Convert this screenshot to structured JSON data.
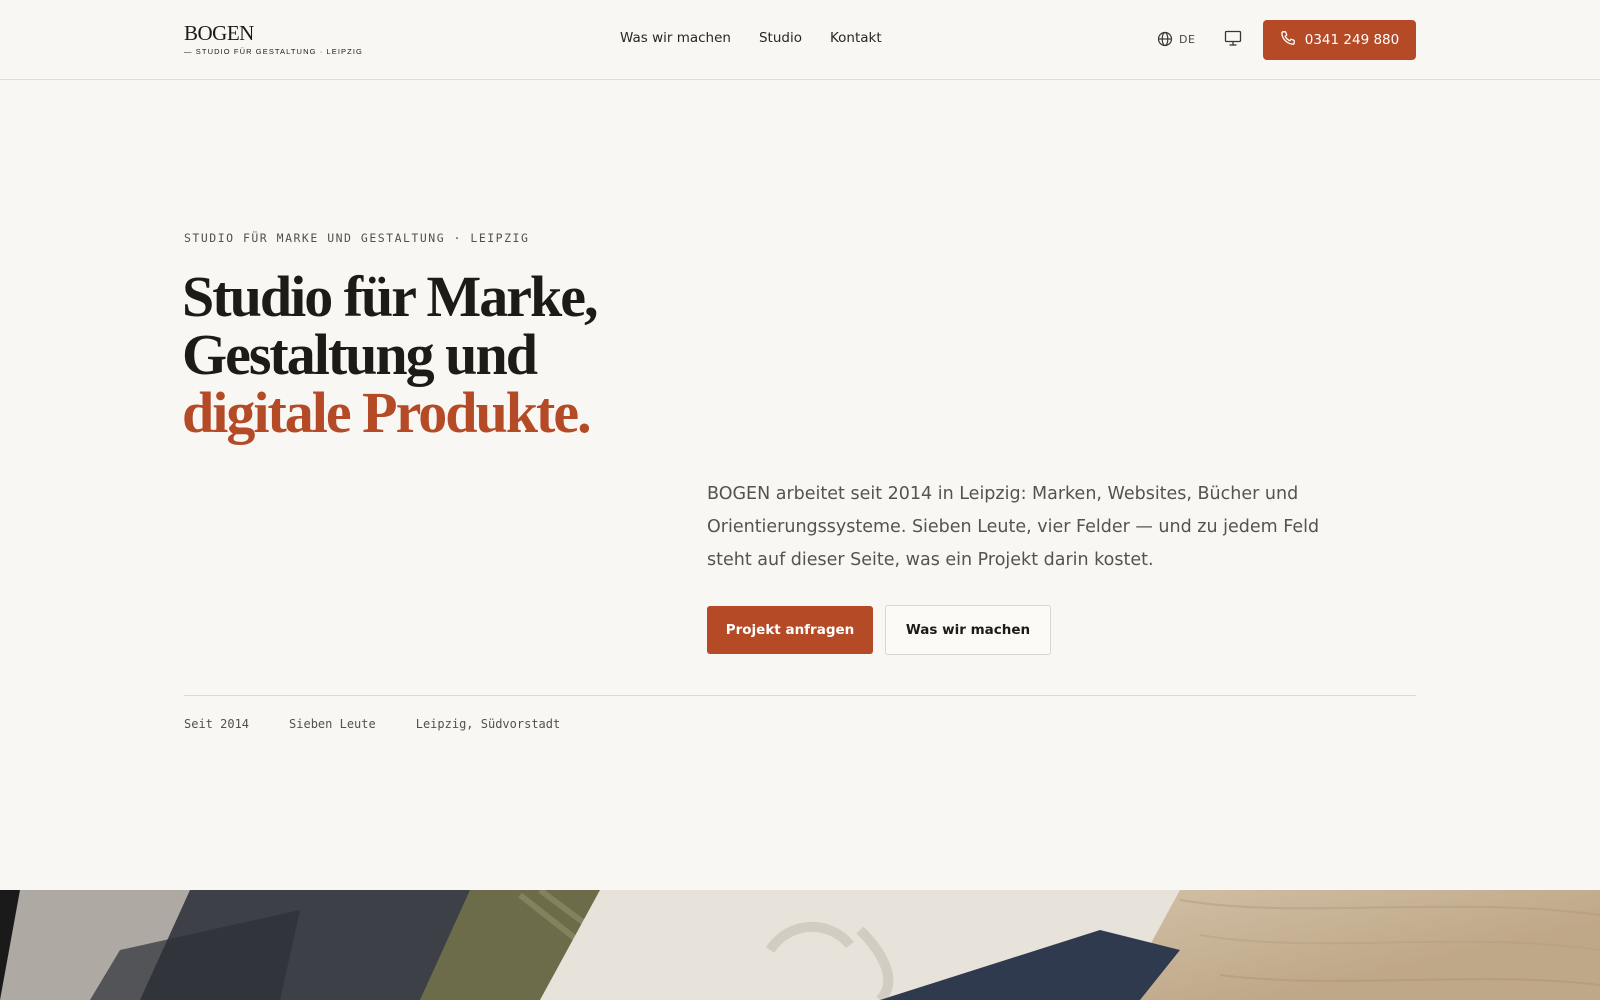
{
  "header": {
    "logo_word": "BOGEN",
    "logo_tagline": "— STUDIO FÜR GESTALTUNG · LEIPZIG",
    "nav": [
      {
        "label": "Was wir machen"
      },
      {
        "label": "Studio"
      },
      {
        "label": "Kontakt"
      }
    ],
    "language": "DE",
    "phone": "0341 249 880"
  },
  "hero": {
    "eyebrow": "STUDIO FÜR MARKE UND GESTALTUNG · LEIPZIG",
    "headline_line1": "Studio für Marke,",
    "headline_line2": "Gestaltung und",
    "headline_accent": "digitale Produkte.",
    "intro": "BOGEN arbeitet seit 2014 in Leipzig: Marken, Websites, Bücher und Orientierungssysteme. Sieben Leute, vier Felder — und zu jedem Feld steht auf dieser Seite, was ein Projekt darin kostet.",
    "cta_primary": "Projekt anfragen",
    "cta_secondary": "Was wir machen",
    "facts": [
      "Seit 2014",
      "Sieben Leute",
      "Leipzig, Südvorstadt"
    ]
  },
  "colors": {
    "accent": "#b54a26",
    "background": "#f9f7f3",
    "text": "#1d1b18"
  },
  "icons": {
    "language": "globe-icon",
    "display": "monitor-icon",
    "phone": "phone-icon"
  }
}
